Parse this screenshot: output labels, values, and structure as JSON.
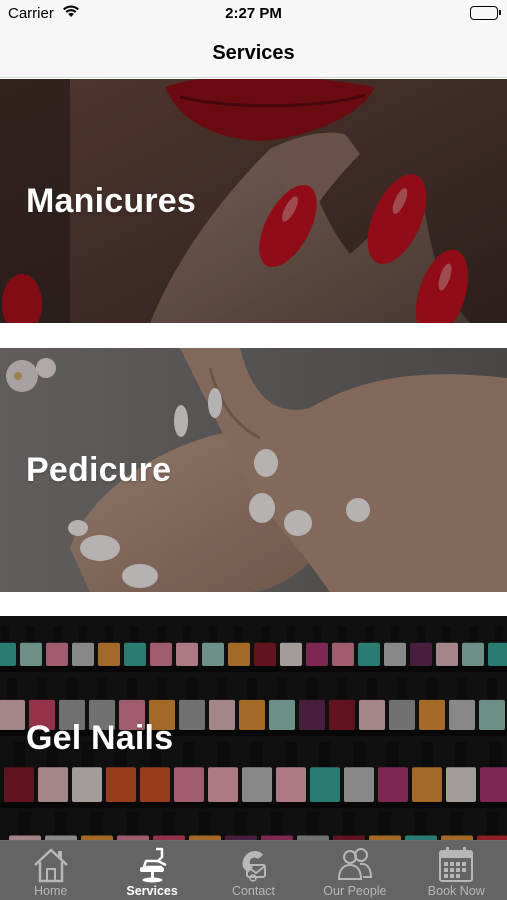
{
  "status_bar": {
    "carrier": "Carrier",
    "time": "2:27 PM"
  },
  "nav": {
    "title": "Services"
  },
  "services": [
    {
      "label": "Manicures"
    },
    {
      "label": "Pedicure"
    },
    {
      "label": "Gel Nails"
    }
  ],
  "tabs": [
    {
      "label": "Home",
      "icon": "home-icon",
      "active": false
    },
    {
      "label": "Services",
      "icon": "salon-chair-icon",
      "active": true
    },
    {
      "label": "Contact",
      "icon": "contact-phone-icon",
      "active": false
    },
    {
      "label": "Our People",
      "icon": "people-icon",
      "active": false
    },
    {
      "label": "Book Now",
      "icon": "calendar-icon",
      "active": false
    }
  ],
  "colors": {
    "tab_bar_bg": "#5c5c5c",
    "tab_active": "#ffffff",
    "tab_inactive": "#b7b7b7",
    "nail_red": "#c0121f"
  }
}
